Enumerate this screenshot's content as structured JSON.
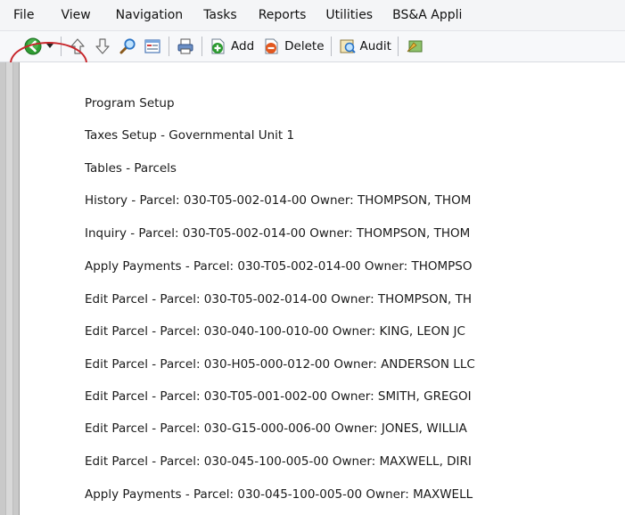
{
  "menubar": {
    "items": [
      "File",
      "View",
      "Navigation",
      "Tasks",
      "Reports",
      "Utilities",
      "BS&A Appli"
    ]
  },
  "toolbar": {
    "add_label": "Add",
    "delete_label": "Delete",
    "audit_label": "Audit",
    "icons": [
      "back-arrow-icon",
      "dropdown-arrow-icon",
      "up-arrow-icon",
      "down-arrow-icon",
      "search-icon",
      "form-icon",
      "print-icon",
      "add-icon",
      "delete-icon",
      "audit-icon",
      "tools-icon"
    ],
    "colors": {
      "back_green": "#2e9c32",
      "add_green": "#2b9a2f",
      "delete_orange": "#e2571e",
      "highlight_ring": "#c8262b"
    }
  },
  "history": {
    "items": [
      "Program Setup",
      "Taxes Setup - Governmental Unit 1",
      "Tables - Parcels",
      "History - Parcel:  030-T05-002-014-00  Owner:  THOMPSON, THOM",
      "Inquiry - Parcel:  030-T05-002-014-00  Owner:  THOMPSON, THOM",
      "Apply Payments - Parcel:  030-T05-002-014-00  Owner:  THOMPSO",
      "Edit Parcel - Parcel:  030-T05-002-014-00  Owner:  THOMPSON, TH",
      "Edit Parcel - Parcel:  030-040-100-010-00  Owner:  KING, LEON  JC",
      "Edit Parcel - Parcel:  030-H05-000-012-00  Owner:  ANDERSON LLC",
      "Edit Parcel - Parcel:  030-T05-001-002-00  Owner:  SMITH, GREGOI",
      "Edit Parcel - Parcel:  030-G15-000-006-00  Owner:  JONES, WILLIA",
      "Edit Parcel - Parcel:  030-045-100-005-00  Owner:  MAXWELL, DIRI",
      "Apply Payments - Parcel:  030-045-100-005-00  Owner:  MAXWELL"
    ]
  }
}
